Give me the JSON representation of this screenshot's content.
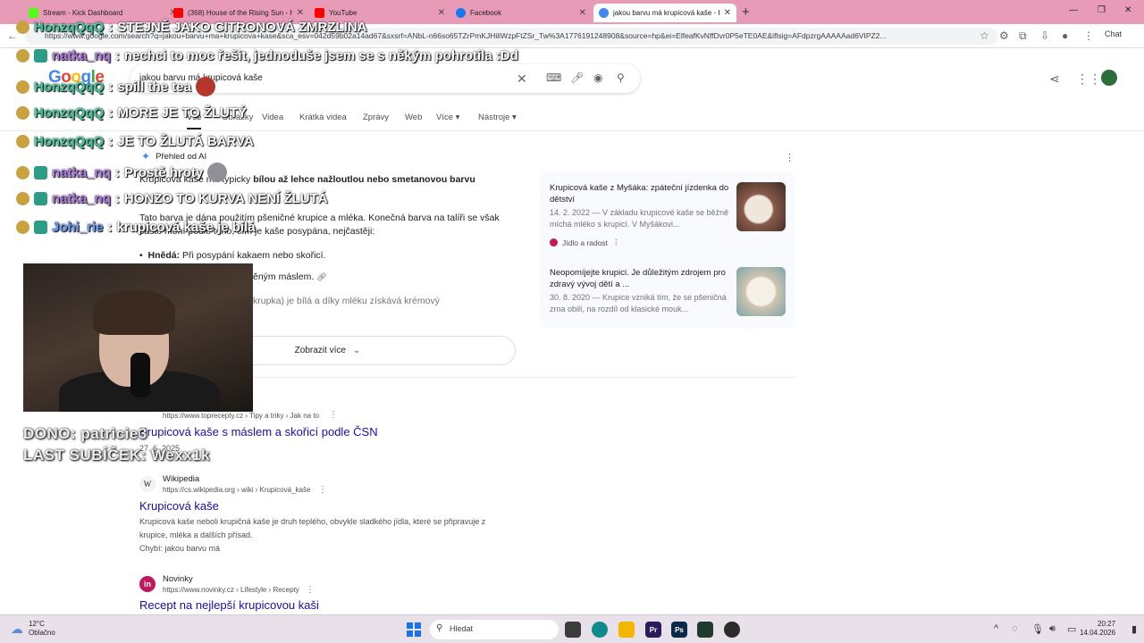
{
  "browser": {
    "tabs": [
      {
        "title": "Stream - Kick Dashboard",
        "favicon_color": "#53fc18",
        "active": false
      },
      {
        "title": "(368) House of the Rising Sun - H",
        "favicon_color": "#ff0000",
        "active": false
      },
      {
        "title": "YouTube",
        "favicon_color": "#ff0000",
        "active": false
      },
      {
        "title": "Facebook",
        "favicon_color": "#1877f2",
        "active": false
      },
      {
        "title": "jakou barvu má krupicová kaše - H",
        "favicon_color": "#4285f4",
        "active": true
      }
    ],
    "new_tab": "+",
    "url": "https://www.google.com/search?q=jakou+barvu+ma+krupicova+kase&sca_esv=042d59b02a14ad67&sxsrf=ANbL-n66so65TZrPmKJHiliWzpFtZSr_Tw%3A1776191248908&source=hp&ei=ElfeafKvNffDvr0P5eTE0AE&iflsig=AFdpzrgAAAAAad6VIPZ2...",
    "chat_label": "Chat"
  },
  "google": {
    "logo": "Google",
    "query": "jakou barvu má krupicová kaše",
    "tabs": [
      "Vše",
      "Obrázky",
      "Videa",
      "Krátká videa",
      "Zprávy",
      "Web",
      "Více ▾",
      "Nástroje ▾"
    ],
    "ai_overview": {
      "title": "Přehled od AI",
      "p1_pre": "Krupicová kaše má typicky ",
      "p1_bold": "bílou až lehce nažloutlou nebo smetanovou barvu",
      "p2": "Tato barva je dána použitím pšeničné krupice a mléka. Konečná barva na talíři se však často mění podle toho, čím je kaše posypána, nejčastěji:",
      "bullet1_bold": "Hnědá:",
      "bullet1_rest": " Při posypání kakaem nebo skořicí.",
      "bullet2": "ěným máslem.",
      "bullet3": "krupka) je bílá a díky mléku získává krémový",
      "show_more": "Zobrazit více"
    },
    "side_cards": [
      {
        "title": "Krupicová kaše z Myšáka: zpáteční jízdenka do dětství",
        "desc": "14. 2. 2022 — V základu krupicové kaše se běžně míchá mléko s krupicí. V Myšákovi...",
        "source": "Jídlo a radost",
        "thumb_color": "#8a5b4a"
      },
      {
        "title": "Neopomíjejte krupici. Je důležitým zdrojem pro zdravý vývoj dětí a ...",
        "desc": "30. 8. 2020 — Krupice vzniká tím, že se pšeničná zrna obilí, na rozdíl od klasické mouk...",
        "source": "",
        "thumb_color": "#cfc4b0"
      }
    ],
    "results": [
      {
        "site": "",
        "cite": "https://www.toprecepty.cz › Tipy a triky › Jak na to",
        "title": "Krupicová kaše s máslem a skořicí podle ČSN",
        "date": "27. 6. 2025",
        "snippet": "",
        "favicon": ""
      },
      {
        "site": "Wikipedia",
        "cite": "https://cs.wikipedia.org › wiki › Krupicová_kaše",
        "title": "Krupicová kaše",
        "snippet": "Krupicová kaše neboli krupičná kaše je druh teplého, obvykle sladkého jídla, které se připravuje z krupice, mléka a dalších přísad.",
        "missing": "Chybí: jakou barvu má",
        "favicon": "W"
      },
      {
        "site": "Novinky",
        "cite": "https://www.novinky.cz › Lifestyle › Recepty",
        "title": "Recept na nejlepší krupicovou kaši",
        "favicon": "in"
      }
    ]
  },
  "overlay": {
    "chat": [
      {
        "user": "HonzqQqQ",
        "msg": "STEJNĚ JAKO CITRONOVÁ ZMRZLINA",
        "style": "honza"
      },
      {
        "user": "natka_nq",
        "msg": "nechci to moc řešit, jednoduše jsem se s někým pohrotila :Dd",
        "style": "natka"
      },
      {
        "user": "HonzqQqQ",
        "msg": "spill the tea",
        "style": "honza"
      },
      {
        "user": "HonzqQqQ",
        "msg": "MORE JE TO ŽLUTÝ",
        "style": "honza"
      },
      {
        "user": "HonzqQqQ",
        "msg": "JE TO ŽLUTÁ BARVA",
        "style": "honza"
      },
      {
        "user": "natka_nq",
        "msg": "Prostě hroty",
        "style": "natka"
      },
      {
        "user": "natka_nq",
        "msg": "HONZO TO KURVA NENÍ ŽLUTÁ",
        "style": "natka"
      },
      {
        "user": "Johi_rie",
        "msg": "krupicová kaše je bílá",
        "style": "johi"
      }
    ],
    "dono": "DONO: patricie3",
    "last_sub": "LAST SUBÍČEK: Wexx1k"
  },
  "taskbar": {
    "temp": "12°C",
    "weather": "Oblačno",
    "search_placeholder": "Hledat",
    "time": "20:27",
    "date": "14.04.2026"
  }
}
